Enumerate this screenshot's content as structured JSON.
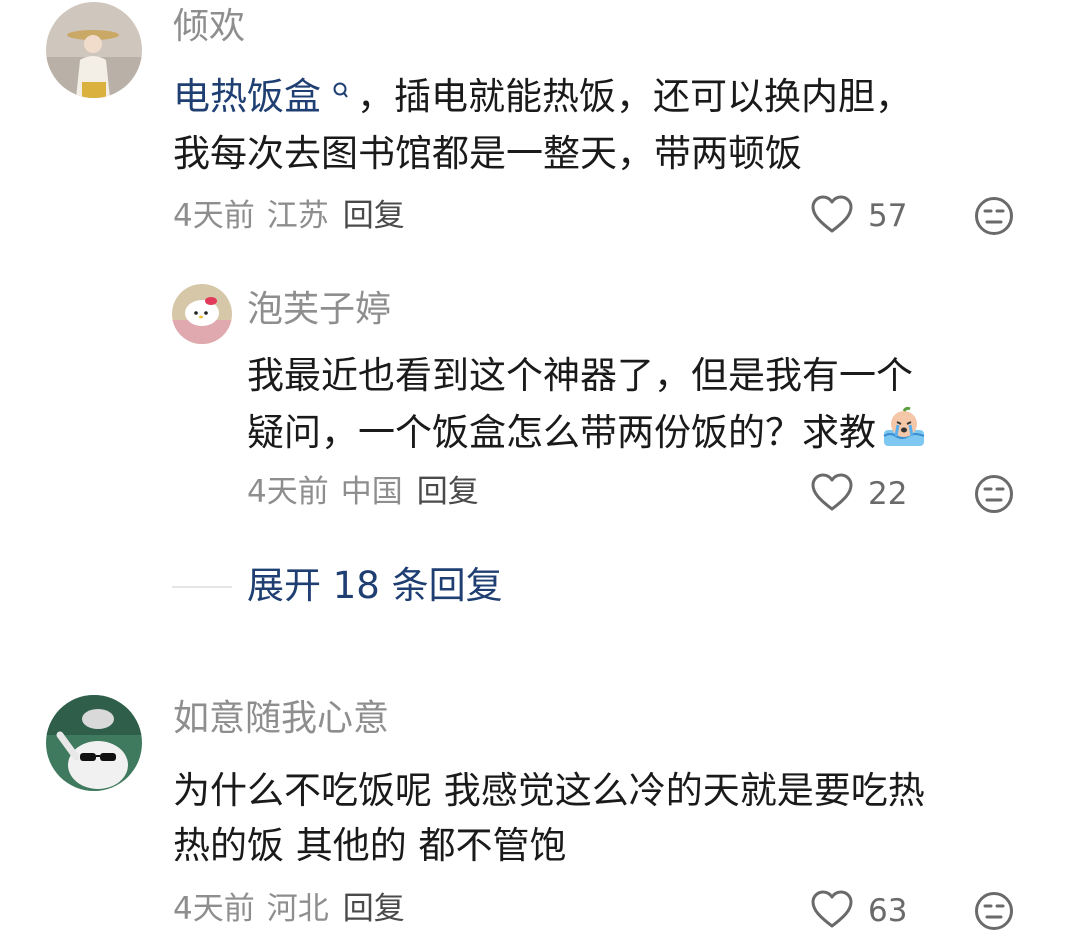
{
  "comments": [
    {
      "user": "倾欢",
      "link_text": "电热饭盒",
      "body_rest_line1": "，插电就能热饭，还可以换内胆，",
      "body_line2": "我每次去图书馆都是一整天，带两顿饭",
      "time": "4天前",
      "location": "江苏",
      "reply": "回复",
      "likes": "57"
    },
    {
      "user": "泡芙子婷",
      "body_line1": "我最近也看到这个神器了，但是我有一个",
      "body_line2": "疑问，一个饭盒怎么带两份饭的？求教",
      "time": "4天前",
      "location": "中国",
      "reply": "回复",
      "likes": "22"
    },
    {
      "user": "如意随我心意",
      "body_line1": "为什么不吃饭呢 我感觉这么冷的天就是要吃热",
      "body_line2": "热的饭 其他的 都不管饱",
      "time": "4天前",
      "location": "河北",
      "reply": "回复",
      "likes": "63"
    }
  ],
  "expand_replies": "展开 18 条回复",
  "icons": {
    "like": "heart-outline-icon",
    "dislike": "neutral-face-icon",
    "search_hint": "search-icon"
  },
  "colors": {
    "link": "#1f3f73",
    "meta": "#8e8e8e",
    "text": "#1a1a1a"
  }
}
